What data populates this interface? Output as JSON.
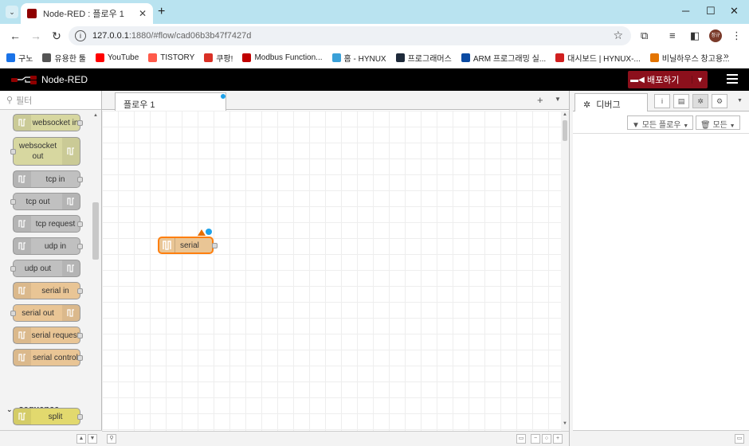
{
  "browser": {
    "tab_title": "Node-RED : 플로우 1",
    "tab_close": "✕",
    "new_tab": "+",
    "url_host": "127.0.0.1",
    "url_path": ":1880/#flow/cad06b3b47f7427d",
    "profile_initial": "정규",
    "bookmarks": [
      {
        "label": "구노",
        "color": "#1a73e8"
      },
      {
        "label": "유용한 툴",
        "color": "#555555"
      },
      {
        "label": "YouTube",
        "color": "#ff0000"
      },
      {
        "label": "TISTORY",
        "color": "#ff5a4a"
      },
      {
        "label": "쿠팡!",
        "color": "#d93025"
      },
      {
        "label": "Modbus Function...",
        "color": "#c00000"
      },
      {
        "label": "홈 - HYNUX",
        "color": "#3aa0d8"
      },
      {
        "label": "프로그래머스",
        "color": "#1e2a3a"
      },
      {
        "label": "ARM 프로그래밍 실...",
        "color": "#0b4aa2"
      },
      {
        "label": "대시보드 | HYNUX-...",
        "color": "#d01f1f"
      },
      {
        "label": "비닐하우스 창고용...",
        "color": "#e37400"
      }
    ]
  },
  "header": {
    "app_name": "Node-RED",
    "deploy_label": "배포하기"
  },
  "palette": {
    "filter_placeholder": "필터",
    "category": "sequence",
    "nodes": [
      {
        "label": "websocket in",
        "color": "#d7d7a0"
      },
      {
        "label": "websocket out",
        "color": "#d7d7a0"
      },
      {
        "label": "tcp in",
        "color": "#c0c0c0"
      },
      {
        "label": "tcp out",
        "color": "#c0c0c0"
      },
      {
        "label": "tcp request",
        "color": "#c0c0c0"
      },
      {
        "label": "udp in",
        "color": "#c0c0c0"
      },
      {
        "label": "udp out",
        "color": "#c0c0c0"
      },
      {
        "label": "serial in",
        "color": "#e9c595"
      },
      {
        "label": "serial out",
        "color": "#e9c595"
      },
      {
        "label": "serial request",
        "color": "#e9c595"
      },
      {
        "label": "serial control",
        "color": "#e9c595"
      },
      {
        "label": "split",
        "color": "#e2d96e"
      }
    ]
  },
  "workspace": {
    "flow_tab": "플로우 1",
    "node_label": "serial"
  },
  "sidebar": {
    "tab_label": "디버그",
    "filter_flows": "모든 플로우",
    "filter_all": "모든"
  }
}
